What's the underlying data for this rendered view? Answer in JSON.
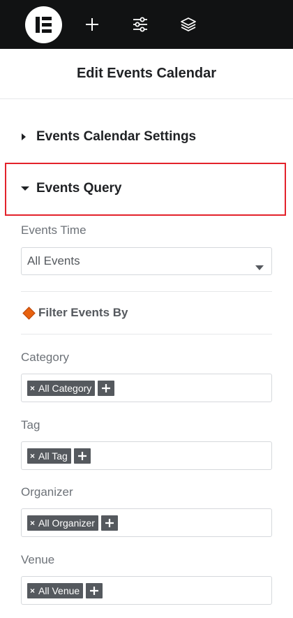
{
  "toolbar": {
    "logo_icon": "elementor-logo-icon",
    "add_icon": "plus-icon",
    "settings_icon": "sliders-icon",
    "navigator_icon": "layers-icon"
  },
  "panel": {
    "title": "Edit Events Calendar"
  },
  "sections": {
    "settings_label": "Events Calendar Settings",
    "query_label": "Events Query"
  },
  "events_time": {
    "label": "Events Time",
    "value": "All Events"
  },
  "filter": {
    "heading": "Filter Events By",
    "accent_color": "#e8620f"
  },
  "filters": [
    {
      "label": "Category",
      "chip": "All Category"
    },
    {
      "label": "Tag",
      "chip": "All Tag"
    },
    {
      "label": "Organizer",
      "chip": "All Organizer"
    },
    {
      "label": "Venue",
      "chip": "All Venue"
    }
  ],
  "chip_remove_glyph": "×",
  "colors": {
    "topbar": "#111213",
    "highlight": "#e3222b",
    "chip": "#55595e"
  }
}
